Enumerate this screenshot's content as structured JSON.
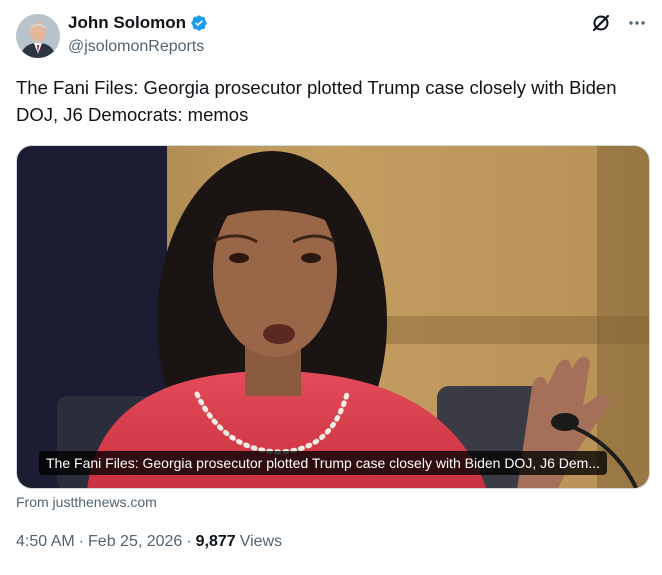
{
  "author": {
    "display_name": "John Solomon",
    "handle": "@jsolomonReports",
    "verified_icon": "verified-badge-icon",
    "badge_color": "#1d9bf0"
  },
  "post": {
    "text": "The Fani Files: Georgia prosecutor plotted Trump case closely with Biden DOJ, J6 Democrats: memos"
  },
  "link_card": {
    "title": "The Fani Files: Georgia prosecutor plotted Trump case closely with Biden DOJ, J6 Dem...",
    "source": "From justthenews.com"
  },
  "meta": {
    "time": "4:50 AM",
    "date": "Feb 25, 2026",
    "views_count": "9,877",
    "views_label": "Views",
    "separator": "·"
  },
  "icons": {
    "grok": "grok-icon",
    "more": "more-icon"
  }
}
